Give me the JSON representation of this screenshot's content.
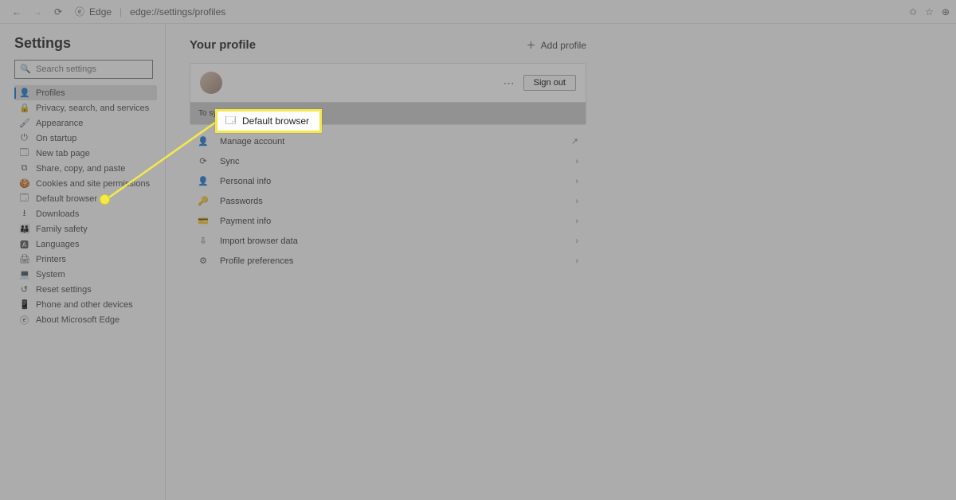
{
  "toolbar": {
    "product": "Edge",
    "url": "edge://settings/profiles"
  },
  "sidebar": {
    "title": "Settings",
    "search_placeholder": "Search settings",
    "items": [
      {
        "icon": "👤",
        "label": "Profiles"
      },
      {
        "icon": "🔒",
        "label": "Privacy, search, and services"
      },
      {
        "icon": "🖌",
        "label": "Appearance"
      },
      {
        "icon": "⏻",
        "label": "On startup"
      },
      {
        "icon": "🗔",
        "label": "New tab page"
      },
      {
        "icon": "⧉",
        "label": "Share, copy, and paste"
      },
      {
        "icon": "🍪",
        "label": "Cookies and site permissions"
      },
      {
        "icon": "🗔",
        "label": "Default browser"
      },
      {
        "icon": "⭳",
        "label": "Downloads"
      },
      {
        "icon": "👪",
        "label": "Family safety"
      },
      {
        "icon": "🅰",
        "label": "Languages"
      },
      {
        "icon": "🖨",
        "label": "Printers"
      },
      {
        "icon": "💻",
        "label": "System"
      },
      {
        "icon": "↺",
        "label": "Reset settings"
      },
      {
        "icon": "📱",
        "label": "Phone and other devices"
      },
      {
        "icon": "ⓔ",
        "label": "About Microsoft Edge"
      }
    ]
  },
  "main": {
    "title": "Your profile",
    "add_profile": "Add profile",
    "sign_out": "Sign out",
    "sync_hint": "To sy",
    "rows": [
      {
        "icon": "👤",
        "label": "Manage account",
        "action": "↗"
      },
      {
        "icon": "⟳",
        "label": "Sync",
        "action": "›"
      },
      {
        "icon": "👤",
        "label": "Personal info",
        "action": "›"
      },
      {
        "icon": "🔑",
        "label": "Passwords",
        "action": "›"
      },
      {
        "icon": "💳",
        "label": "Payment info",
        "action": "›"
      },
      {
        "icon": "⇩",
        "label": "Import browser data",
        "action": "›"
      },
      {
        "icon": "⚙",
        "label": "Profile preferences",
        "action": "›"
      }
    ]
  },
  "callout": {
    "icon": "🗔",
    "label": "Default browser"
  }
}
